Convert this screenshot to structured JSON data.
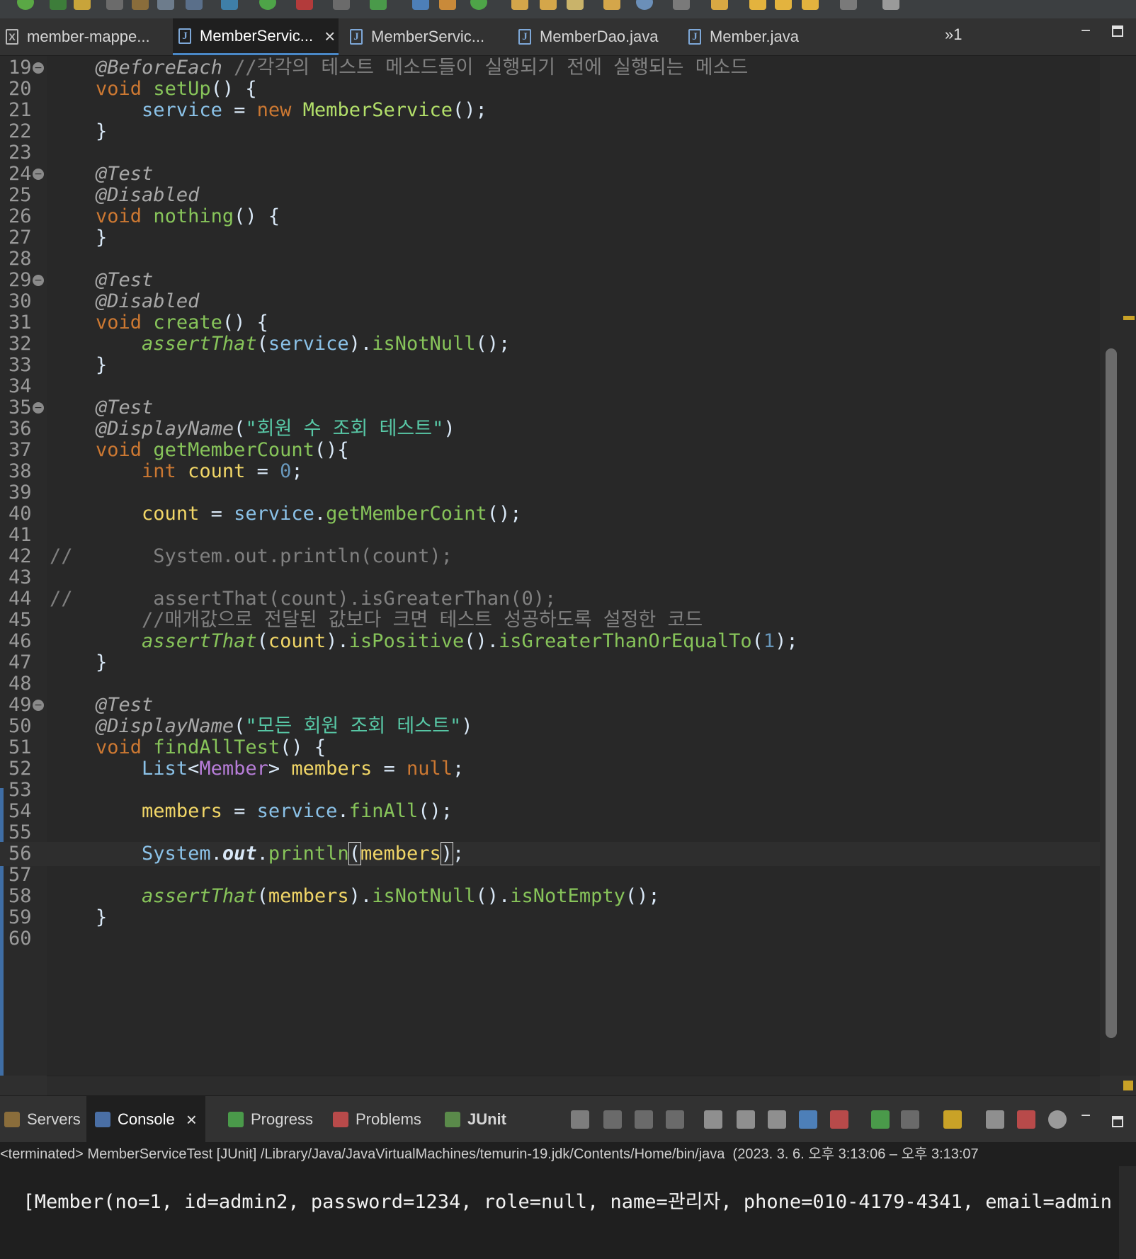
{
  "editor_tabs": [
    {
      "label": "member-mappe...",
      "icon": "xml-file-icon",
      "active": false
    },
    {
      "label": "MemberServic...",
      "icon": "java-test-file-icon",
      "active": true
    },
    {
      "label": "MemberServic...",
      "icon": "java-file-icon",
      "active": false
    },
    {
      "label": "MemberDao.java",
      "icon": "java-file-icon",
      "active": false
    },
    {
      "label": "Member.java",
      "icon": "java-file-icon",
      "active": false
    }
  ],
  "tab_overflow": "»1",
  "code_lines": [
    {
      "n": "19",
      "fold": true
    },
    {
      "n": "20"
    },
    {
      "n": "21"
    },
    {
      "n": "22"
    },
    {
      "n": "23"
    },
    {
      "n": "24",
      "fold": true
    },
    {
      "n": "25"
    },
    {
      "n": "26"
    },
    {
      "n": "27"
    },
    {
      "n": "28"
    },
    {
      "n": "29",
      "fold": true
    },
    {
      "n": "30"
    },
    {
      "n": "31"
    },
    {
      "n": "32"
    },
    {
      "n": "33"
    },
    {
      "n": "34"
    },
    {
      "n": "35",
      "fold": true
    },
    {
      "n": "36"
    },
    {
      "n": "37"
    },
    {
      "n": "38"
    },
    {
      "n": "39"
    },
    {
      "n": "40"
    },
    {
      "n": "41"
    },
    {
      "n": "42"
    },
    {
      "n": "43"
    },
    {
      "n": "44"
    },
    {
      "n": "45"
    },
    {
      "n": "46"
    },
    {
      "n": "47"
    },
    {
      "n": "48"
    },
    {
      "n": "49",
      "fold": true
    },
    {
      "n": "50"
    },
    {
      "n": "51"
    },
    {
      "n": "52"
    },
    {
      "n": "53"
    },
    {
      "n": "54"
    },
    {
      "n": "55"
    },
    {
      "n": "56",
      "current": true
    },
    {
      "n": "57"
    },
    {
      "n": "58"
    },
    {
      "n": "59"
    },
    {
      "n": "60"
    }
  ],
  "code": {
    "l19_ann": "@BeforeEach",
    "l19_cm": " //각각의 테스트 메소드들이 실행되기 전에 실행되는 메소드",
    "kw_void": "void",
    "fn_setUp": "setUp",
    "l20_rest": "() {",
    "l21_var": "service",
    "l21_eq": " = ",
    "kw_new": "new",
    "l21_cls": "MemberService",
    "l21_end": "();",
    "brace_close": "}",
    "ann_test": "@Test",
    "ann_disabled": "@Disabled",
    "fn_nothing": "nothing",
    "l26_rest": "() {",
    "fn_create": "create",
    "l31_rest": "() {",
    "assertThat": "assertThat",
    "l32_open": "(",
    "l32_var": "service",
    "l32_mid": ").",
    "fn_isNotNull": "isNotNull",
    "l32_end": "();",
    "ann_displayname": "@DisplayName",
    "l36_open": "(",
    "l36_str": "\"회원 수 조회 테스트\"",
    "l36_close": ")",
    "fn_getMemberCount": "getMemberCount",
    "l37_rest": "(){",
    "kw_int": "int",
    "l38_fld": "count",
    "l38_eq": " = ",
    "l38_num": "0",
    "l38_end": ";",
    "l40_fld": "count",
    "l40_eq": " = ",
    "l40_var": "service",
    "l40_dot": ".",
    "fn_getMemberCoint": "getMemberCoint",
    "l40_end": "();",
    "l42_cm": "//       System.out.println(count);",
    "l44_cm": "//       assertThat(count).isGreaterThan(0);",
    "l45_cm": "//매개값으로 전달된 값보다 크면 테스트 성공하도록 설정한 코드",
    "l46_open": "(",
    "l46_fld": "count",
    "l46_mid": ").",
    "fn_isPositive": "isPositive",
    "l46_mid2": "().",
    "fn_isGreaterThanOrEqualTo": "isGreaterThanOrEqualTo",
    "l46_open2": "(",
    "l46_num": "1",
    "l46_end": ");",
    "l50_str": "\"모든 회원 조회 테스트\"",
    "fn_findAllTest": "findAllTest",
    "l51_rest": "() {",
    "l52_list": "List",
    "l52_lt": "<",
    "l52_typ": "Member",
    "l52_gt": "> ",
    "l52_fld": "members",
    "l52_eq": " = ",
    "kw_null": "null",
    "l52_end": ";",
    "l54_fld": "members",
    "l54_eq": " = ",
    "l54_var": "service",
    "l54_dot": ".",
    "fn_finAll": "finAll",
    "l54_end": "();",
    "l56_sys": "System",
    "l56_dot": ".",
    "l56_out": "out",
    "l56_dot2": ".",
    "fn_println": "println",
    "l56_open": "(",
    "l56_fld": "members",
    "l56_close": ")",
    "l56_end": ";",
    "l58_open": "(",
    "l58_fld": "members",
    "l58_mid": ").",
    "l58_mid2": "().",
    "fn_isNotEmpty": "isNotEmpty",
    "l58_end": "();"
  },
  "views": {
    "tabs": [
      {
        "label": "Servers",
        "icon": "servers-icon"
      },
      {
        "label": "Console",
        "icon": "console-icon",
        "active": true
      },
      {
        "label": "Progress",
        "icon": "progress-icon"
      },
      {
        "label": "Problems",
        "icon": "problems-icon"
      },
      {
        "label": "JUnit",
        "icon": "junit-icon"
      }
    ]
  },
  "console": {
    "header": "<terminated> MemberServiceTest [JUnit] /Library/Java/JavaVirtualMachines/temurin-19.jdk/Contents/Home/bin/java  (2023. 3. 6. 오후 3:13:06 – 오후 3:13:07",
    "output": "[Member(no=1, id=admin2, password=1234, role=null, name=관리자, phone=010-4179-4341, email=admin"
  },
  "colors": {
    "editor_bg": "#282828",
    "keyword": "#cc7832",
    "method": "#87c45a",
    "string": "#58c8a6",
    "field": "#f1d667",
    "comment": "#808080",
    "active_tab_underline": "#4a88c7"
  }
}
